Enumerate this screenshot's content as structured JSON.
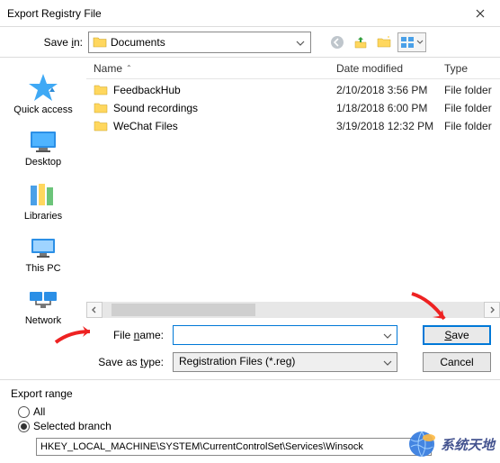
{
  "window": {
    "title": "Export Registry File",
    "close": "✕"
  },
  "toolbar": {
    "savein_label_prefix": "Save ",
    "savein_label_ul": "i",
    "savein_label_suffix": "n:",
    "location": "Documents",
    "icons": {
      "back": "back-icon",
      "up": "up-icon",
      "new_folder": "new-folder-icon",
      "view": "view-icon"
    }
  },
  "sidebar": [
    {
      "id": "quick-access",
      "label": "Quick access"
    },
    {
      "id": "desktop",
      "label": "Desktop"
    },
    {
      "id": "libraries",
      "label": "Libraries"
    },
    {
      "id": "this-pc",
      "label": "This PC"
    },
    {
      "id": "network",
      "label": "Network"
    }
  ],
  "columns": {
    "name": "Name",
    "date": "Date modified",
    "type": "Type"
  },
  "files": [
    {
      "name": "FeedbackHub",
      "date": "2/10/2018 3:56 PM",
      "type": "File folder"
    },
    {
      "name": "Sound recordings",
      "date": "1/18/2018 6:00 PM",
      "type": "File folder"
    },
    {
      "name": "WeChat Files",
      "date": "3/19/2018 12:32 PM",
      "type": "File folder"
    }
  ],
  "form": {
    "filename_label_prefix": "File ",
    "filename_label_ul": "n",
    "filename_label_suffix": "ame:",
    "filename_value": "",
    "savetype_label_prefix": "Save as ",
    "savetype_label_ul": "t",
    "savetype_label_suffix": "ype:",
    "savetype_value": "Registration Files (*.reg)"
  },
  "buttons": {
    "save_prefix": "",
    "save_ul": "S",
    "save_suffix": "ave",
    "cancel": "Cancel"
  },
  "export_range": {
    "title": "Export range",
    "all_ul": "A",
    "all_suffix": "ll",
    "selected_ul": "S",
    "selected_suffix": "elected branch",
    "branch_value": "HKEY_LOCAL_MACHINE\\SYSTEM\\CurrentControlSet\\Services\\Winsock"
  },
  "watermark": "系统天地"
}
